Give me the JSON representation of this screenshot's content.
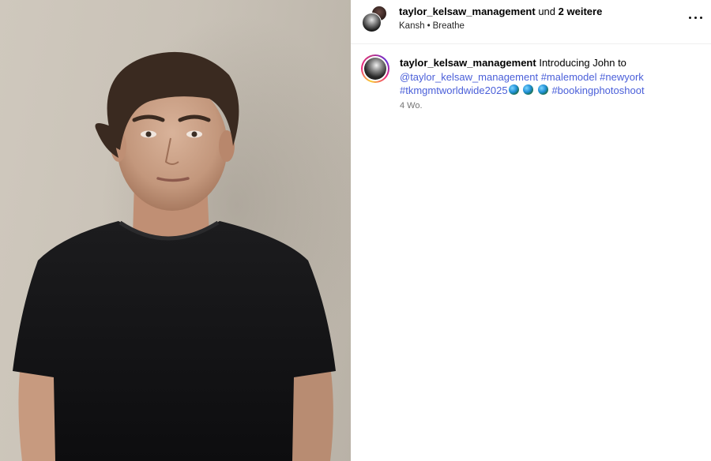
{
  "header": {
    "username": "taylor_kelsaw_management",
    "joiner": "und",
    "collaborators": "2 weitere",
    "audio_artist": "Kansh",
    "separator": "•",
    "audio_title": "Breathe",
    "more_icon": "more-horizontal-icon"
  },
  "caption": {
    "username": "taylor_kelsaw_management",
    "text": "Introducing John to",
    "mention": "@taylor_kelsaw_management",
    "tags": [
      "#malemodel",
      "#newyork",
      "#tkmgmtworldwide2025",
      "#bookingphotoshoot"
    ],
    "emoji_icon": "globe-icon",
    "timestamp": "4 Wo."
  },
  "colors": {
    "link": "#4a5fd9",
    "timestamp": "#737373",
    "divider": "#efefef"
  }
}
